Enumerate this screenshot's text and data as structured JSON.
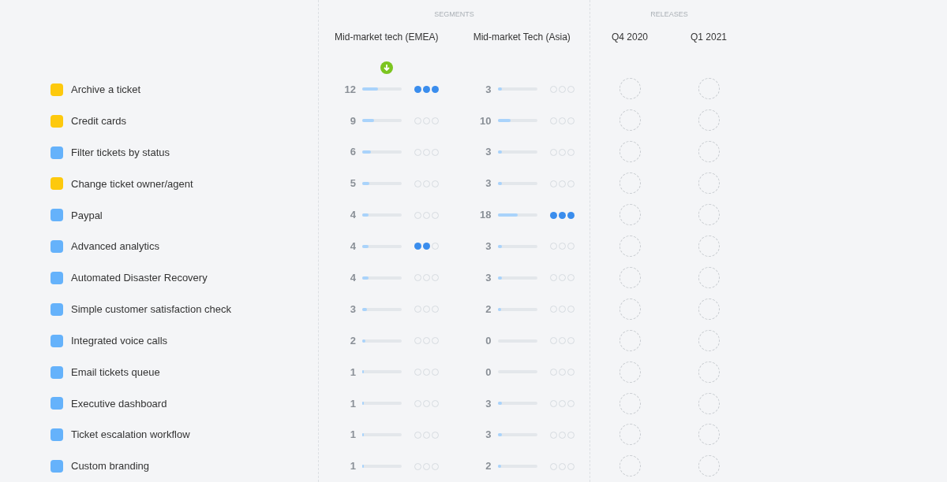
{
  "segments_header": "SEGMENTS",
  "releases_header": "RELEASES",
  "segments": [
    {
      "title": "Mid-market tech (EMEA)",
      "sorted": true
    },
    {
      "title": "Mid-market Tech (Asia)",
      "sorted": false
    }
  ],
  "releases": [
    {
      "title": "Q4 2020"
    },
    {
      "title": "Q1 2021"
    }
  ],
  "rows": [
    {
      "name": "Archive a ticket",
      "color": "#fdc90d",
      "values": [
        {
          "count": "12",
          "level": 0.4,
          "stars": 3
        },
        {
          "count": "3",
          "level": 0.1,
          "stars": 0
        }
      ]
    },
    {
      "name": "Credit cards",
      "color": "#fdc90d",
      "values": [
        {
          "count": "9",
          "level": 0.3,
          "stars": 0
        },
        {
          "count": "10",
          "level": 0.33,
          "stars": 0
        }
      ]
    },
    {
      "name": "Filter tickets by status",
      "color": "#65b2fb",
      "values": [
        {
          "count": "6",
          "level": 0.22,
          "stars": 0
        },
        {
          "count": "3",
          "level": 0.1,
          "stars": 0
        }
      ]
    },
    {
      "name": "Change ticket owner/agent",
      "color": "#fdc90d",
      "values": [
        {
          "count": "5",
          "level": 0.18,
          "stars": 0
        },
        {
          "count": "3",
          "level": 0.1,
          "stars": 0
        }
      ]
    },
    {
      "name": "Paypal",
      "color": "#65b2fb",
      "values": [
        {
          "count": "4",
          "level": 0.15,
          "stars": 0
        },
        {
          "count": "18",
          "level": 0.5,
          "stars": 3
        }
      ]
    },
    {
      "name": "Advanced analytics",
      "color": "#65b2fb",
      "values": [
        {
          "count": "4",
          "level": 0.15,
          "stars": 2
        },
        {
          "count": "3",
          "level": 0.1,
          "stars": 0
        }
      ]
    },
    {
      "name": "Automated Disaster Recovery",
      "color": "#65b2fb",
      "values": [
        {
          "count": "4",
          "level": 0.15,
          "stars": 0
        },
        {
          "count": "3",
          "level": 0.1,
          "stars": 0
        }
      ]
    },
    {
      "name": "Simple customer satisfaction check",
      "color": "#65b2fb",
      "values": [
        {
          "count": "3",
          "level": 0.12,
          "stars": 0
        },
        {
          "count": "2",
          "level": 0.08,
          "stars": 0
        }
      ]
    },
    {
      "name": "Integrated voice calls",
      "color": "#65b2fb",
      "values": [
        {
          "count": "2",
          "level": 0.08,
          "stars": 0
        },
        {
          "count": "0",
          "stars": 0
        }
      ]
    },
    {
      "name": "Email tickets queue",
      "color": "#65b2fb",
      "values": [
        {
          "count": "1",
          "level": 0.04,
          "stars": 0
        },
        {
          "count": "0",
          "stars": 0
        }
      ]
    },
    {
      "name": "Executive dashboard",
      "color": "#65b2fb",
      "values": [
        {
          "count": "1",
          "level": 0.04,
          "stars": 0
        },
        {
          "count": "3",
          "level": 0.1,
          "stars": 0
        }
      ]
    },
    {
      "name": "Ticket escalation workflow",
      "color": "#65b2fb",
      "values": [
        {
          "count": "1",
          "level": 0.04,
          "stars": 0
        },
        {
          "count": "3",
          "level": 0.1,
          "stars": 0
        }
      ]
    },
    {
      "name": "Custom branding",
      "color": "#65b2fb",
      "values": [
        {
          "count": "1",
          "level": 0.04,
          "stars": 0
        },
        {
          "count": "2",
          "level": 0.08,
          "stars": 0
        }
      ]
    }
  ]
}
